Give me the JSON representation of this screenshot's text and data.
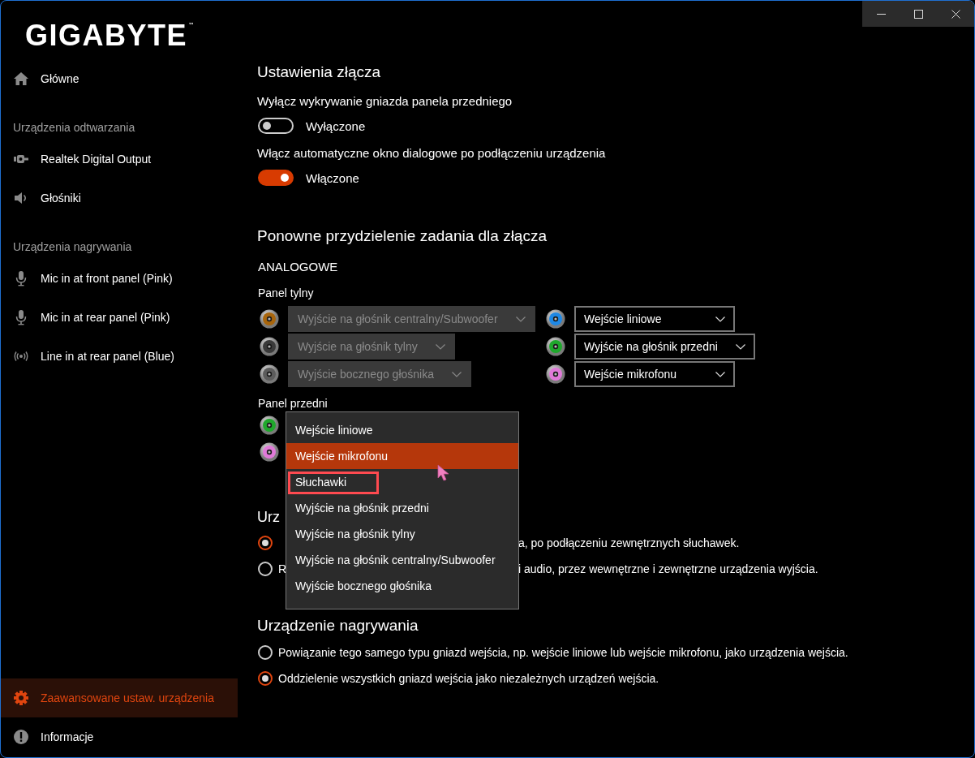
{
  "logo": {
    "text": "GIGABYTE",
    "mark": "™"
  },
  "window_controls": [
    {
      "kind": "minimize"
    },
    {
      "kind": "maximize"
    },
    {
      "kind": "close"
    }
  ],
  "sidebar": {
    "items": [
      {
        "kind": "item",
        "label": "Główne",
        "selected": false
      },
      {
        "kind": "header",
        "label": "Urządzenia odtwarzania"
      },
      {
        "kind": "item",
        "label": "Realtek Digital Output",
        "selected": false
      },
      {
        "kind": "item",
        "label": "Głośniki",
        "selected": false
      },
      {
        "kind": "header",
        "label": "Urządzenia nagrywania"
      },
      {
        "kind": "item",
        "label": "Mic in at front panel (Pink)",
        "selected": false
      },
      {
        "kind": "item",
        "label": "Mic in at rear panel (Pink)",
        "selected": false
      },
      {
        "kind": "item",
        "label": "Line in at rear panel (Blue)",
        "selected": false
      }
    ],
    "bottom_items": [
      {
        "kind": "item",
        "label": "Zaawansowane ustaw. urządzenia",
        "selected": true
      },
      {
        "kind": "item",
        "label": "Informacje",
        "selected": false
      }
    ]
  },
  "connector_settings": {
    "title": "Ustawienia złącza",
    "options": [
      {
        "label": "Wyłącz wykrywanie gniazda panela przedniego",
        "on": false,
        "state_label": "Wyłączone"
      },
      {
        "label": "Włącz automatyczne okno dialogowe po podłączeniu urządzenia",
        "on": true,
        "state_label": "Włączone"
      }
    ]
  },
  "reassignment": {
    "title": "Ponowne przydzielenie zadania dla złącza",
    "group": "ANALOGOWE",
    "rear_panel": {
      "label": "Panel tylny",
      "left_jacks": [
        {
          "color": "#a8650c",
          "value": "Wyjście na głośnik centralny/Subwoofer",
          "disabled": true
        },
        {
          "color": "#3a3a3a",
          "value": "Wyjście na głośnik tylny",
          "disabled": true
        },
        {
          "color": "#5c5c5c",
          "value": "Wyjście bocznego głośnika",
          "disabled": true
        }
      ],
      "right_jacks": [
        {
          "color": "#1e88e5",
          "value": "Wejście liniowe",
          "disabled": false
        },
        {
          "color": "#1fa82c",
          "value": "Wyjście na głośnik przedni",
          "disabled": false
        },
        {
          "color": "#e07ad8",
          "value": "Wejście mikrofonu",
          "disabled": false
        }
      ]
    },
    "front_panel": {
      "label": "Panel przedni",
      "jacks": [
        {
          "color": "#1fa82c"
        },
        {
          "color": "#e07ad8"
        }
      ]
    }
  },
  "dropdown_menu": {
    "items": [
      {
        "label": "Wejście liniowe",
        "selected": false,
        "highlighted": false
      },
      {
        "label": "Wejście mikrofonu",
        "selected": true,
        "highlighted": false
      },
      {
        "label": "Słuchawki",
        "selected": false,
        "highlighted": true
      },
      {
        "label": "Wyjście na głośnik przedni",
        "selected": false,
        "highlighted": false
      },
      {
        "label": "Wyjście na głośnik tylny",
        "selected": false,
        "highlighted": false
      },
      {
        "label": "Wyjście na głośnik centralny/Subwoofer",
        "selected": false,
        "highlighted": false
      },
      {
        "label": "Wyjście bocznego głośnika",
        "selected": false,
        "highlighted": false
      }
    ]
  },
  "output_device": {
    "title": "Urz",
    "options": [
      {
        "selected": true,
        "text_end": "a, po podłączeniu zewnętrznych słuchawek."
      },
      {
        "selected": false,
        "text_start": "R",
        "text_end": "i audio, przez wewnętrzne i zewnętrzne urządzenia wyjścia."
      }
    ]
  },
  "recording_device": {
    "title": "Urządzenie nagrywania",
    "options": [
      {
        "selected": false,
        "text": "Powiązanie tego samego typu gniazd wejścia, np. wejście liniowe lub wejście mikrofonu, jako urządzenia wejścia."
      },
      {
        "selected": true,
        "text": "Oddzielenie wszystkich gniazd wejścia jako niezależnych urządzeń wejścia."
      }
    ]
  }
}
